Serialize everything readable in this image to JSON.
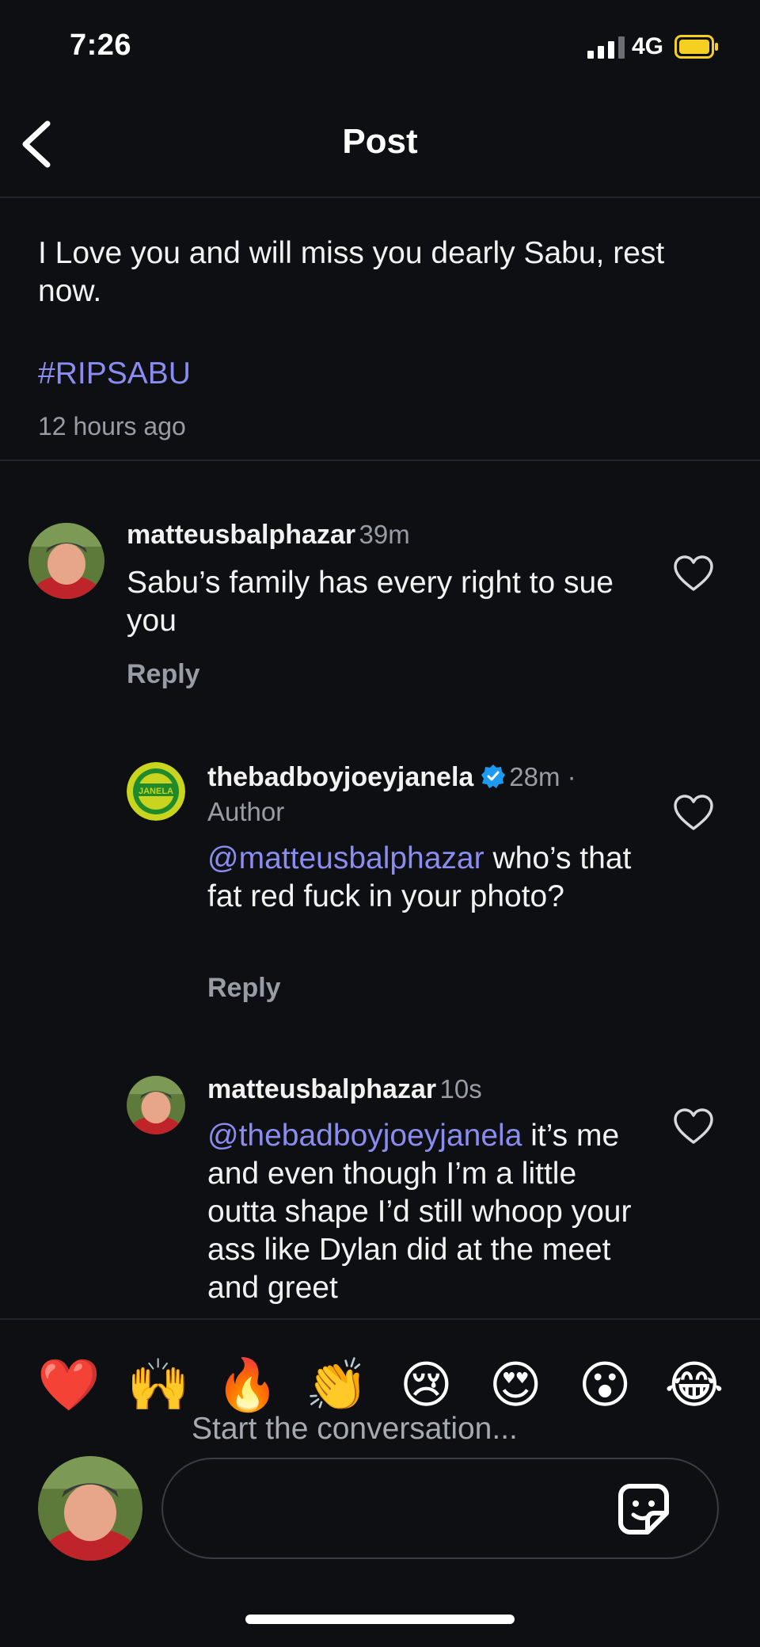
{
  "status_bar": {
    "time": "7:26",
    "network": "4G"
  },
  "header": {
    "title": "Post"
  },
  "post": {
    "text": "I Love you and will miss you dearly Sabu, rest now.",
    "hashtag": "#RIPSABU",
    "timestamp": "12 hours ago"
  },
  "comments": [
    {
      "username": "matteusbalphazar",
      "time": "39m",
      "text": "Sabu’s family has every right to sue you",
      "reply_label": "Reply"
    },
    {
      "username": "thebadboyjoeyjanela",
      "time": "28m ·",
      "author_label": "Author",
      "mention": "@matteusbalphazar",
      "text": " who’s that fat red fuck in your photo?",
      "reply_label": "Reply",
      "avatar_text": "JANELA"
    },
    {
      "username": "matteusbalphazar",
      "time": "10s",
      "mention": "@thebadboyjoeyjanela",
      "text": " it’s me and even though I’m a little outta shape I’d still whoop your ass like Dylan did at the meet and greet"
    }
  ],
  "reactions": [
    "❤️",
    "🙌",
    "🔥",
    "👏",
    "😢",
    "😍",
    "😮",
    "😂"
  ],
  "composer": {
    "hint": "Start the conversation..."
  },
  "colors": {
    "background": "#0e0f13",
    "mention": "#8a8cf0",
    "verified": "#1d9bf0",
    "battery": "#f5d020"
  }
}
